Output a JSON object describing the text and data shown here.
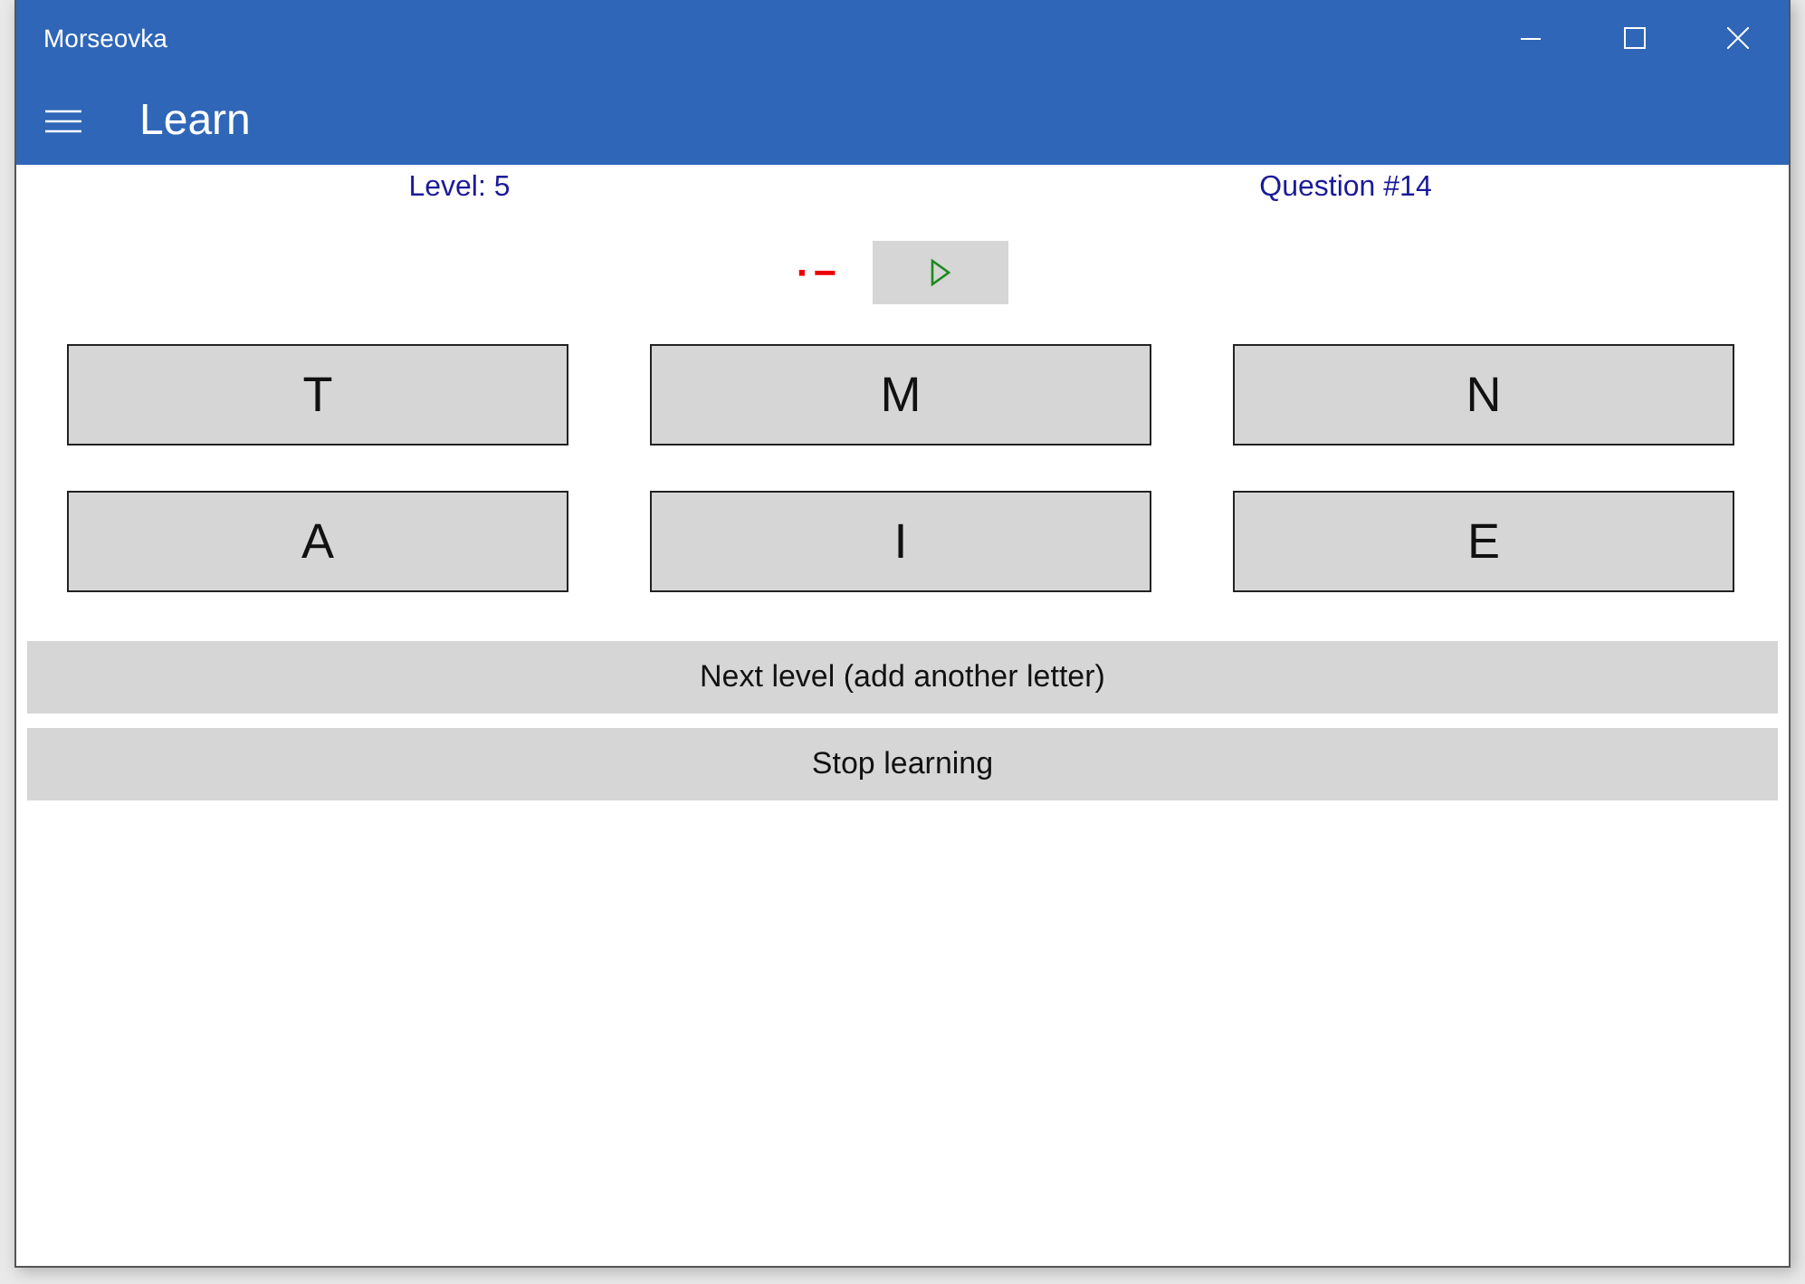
{
  "window": {
    "title": "Morseovka"
  },
  "header": {
    "title": "Learn"
  },
  "status": {
    "level": "Level: 5",
    "question": "Question #14"
  },
  "morse": "·−",
  "answers": [
    "T",
    "M",
    "N",
    "A",
    "I",
    "E"
  ],
  "actions": [
    "Next level (add another letter)",
    "Stop learning"
  ]
}
